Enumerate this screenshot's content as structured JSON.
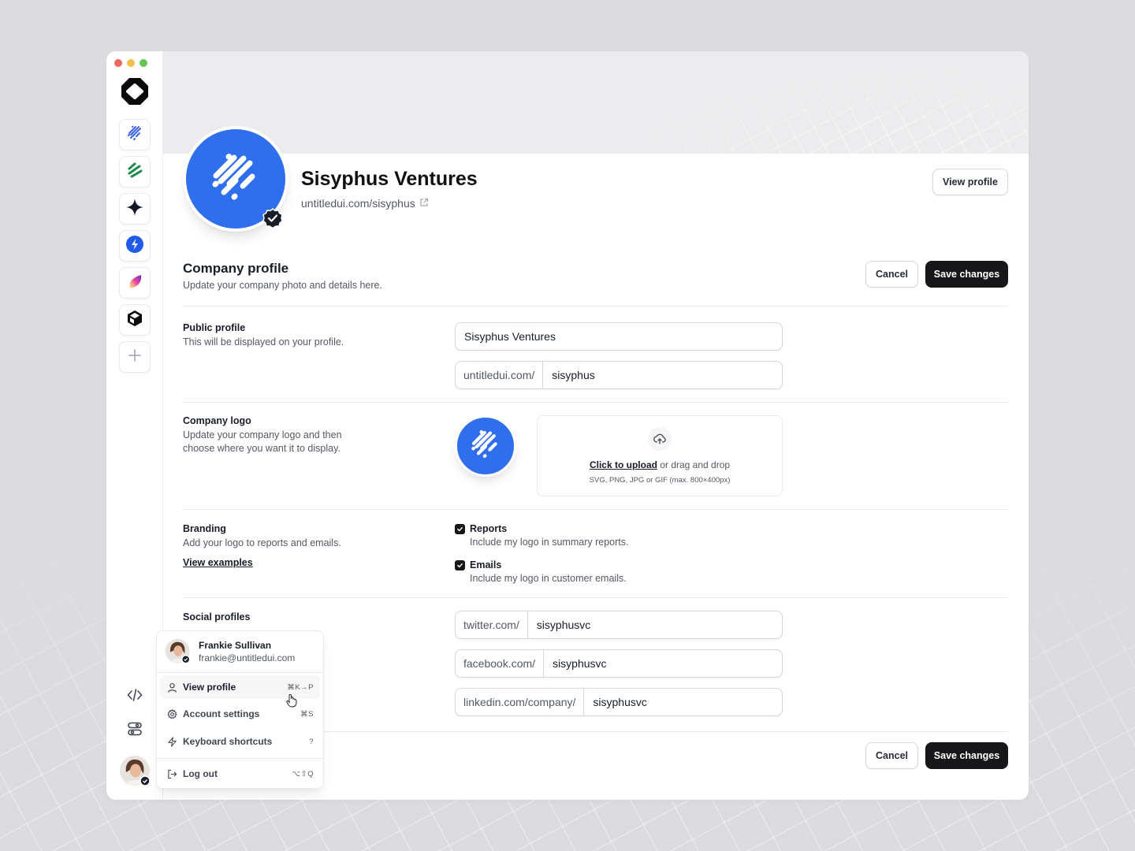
{
  "window": {
    "traffic_lights": [
      "#ec6a5e",
      "#f4bf4f",
      "#61c554"
    ]
  },
  "sidebar": {
    "logo_icon": "octagon-logo-icon",
    "apps": [
      {
        "name": "lines-app",
        "icon": "diagonal-lines-icon",
        "color": "#3e63dd"
      },
      {
        "name": "waves-app",
        "icon": "green-waves-icon",
        "color": "#1f8a4c"
      },
      {
        "name": "sparkle-app",
        "icon": "sparkle-icon",
        "color": "#101828"
      },
      {
        "name": "bolt-app",
        "icon": "bolt-icon",
        "color": "#1f5ae8"
      },
      {
        "name": "gradient-app",
        "icon": "gradient-leaf-icon",
        "color": "#8b5cf6"
      },
      {
        "name": "cube-app",
        "icon": "cube-icon",
        "color": "#0a0a0a"
      },
      {
        "name": "add-app",
        "icon": "plus-icon",
        "color": "#98a2b3"
      }
    ],
    "bottom_icons": [
      "code-icon",
      "toggles-icon"
    ],
    "user_avatar": "avatar-frankie"
  },
  "header": {
    "company_name": "Sisyphus Ventures",
    "company_url": "untitledui.com/sisyphus",
    "view_profile_label": "View profile",
    "brand_color": "#2f6fed"
  },
  "section": {
    "title": "Company profile",
    "subtitle": "Update your company photo and details here.",
    "cancel_label": "Cancel",
    "save_label": "Save changes"
  },
  "public_profile": {
    "label": "Public profile",
    "description": "This will be displayed on your profile.",
    "name_value": "Sisyphus Ventures",
    "url_prefix": "untitledui.com/",
    "url_value": "sisyphus"
  },
  "company_logo": {
    "label": "Company logo",
    "description": "Update your company logo and then choose where you want it to display.",
    "upload_link": "Click to upload",
    "upload_text": "or drag and drop",
    "upload_hint": "SVG, PNG, JPG or GIF (max. 800×400px)"
  },
  "branding": {
    "label": "Branding",
    "description": "Add your logo to reports and emails.",
    "link": "View examples",
    "options": [
      {
        "label": "Reports",
        "description": "Include my logo in summary reports.",
        "checked": true
      },
      {
        "label": "Emails",
        "description": "Include my logo in customer emails.",
        "checked": true
      }
    ]
  },
  "social": {
    "label": "Social profiles",
    "fields": [
      {
        "prefix": "twitter.com/",
        "value": "sisyphusvc"
      },
      {
        "prefix": "facebook.com/",
        "value": "sisyphusvc"
      },
      {
        "prefix": "linkedin.com/company/",
        "value": "sisyphusvc"
      }
    ]
  },
  "footer": {
    "cancel_label": "Cancel",
    "save_label": "Save changes"
  },
  "user_menu": {
    "name": "Frankie Sullivan",
    "email": "frankie@untitledui.com",
    "items": [
      {
        "label": "View profile",
        "shortcut": "⌘K→P",
        "icon": "user-icon",
        "active": true
      },
      {
        "label": "Account settings",
        "shortcut": "⌘S",
        "icon": "gear-icon",
        "active": false
      },
      {
        "label": "Keyboard shortcuts",
        "shortcut": "?",
        "icon": "bolt-outline-icon",
        "active": false
      },
      {
        "label": "Log out",
        "shortcut": "⌥⇧Q",
        "icon": "logout-icon",
        "active": false
      }
    ]
  }
}
